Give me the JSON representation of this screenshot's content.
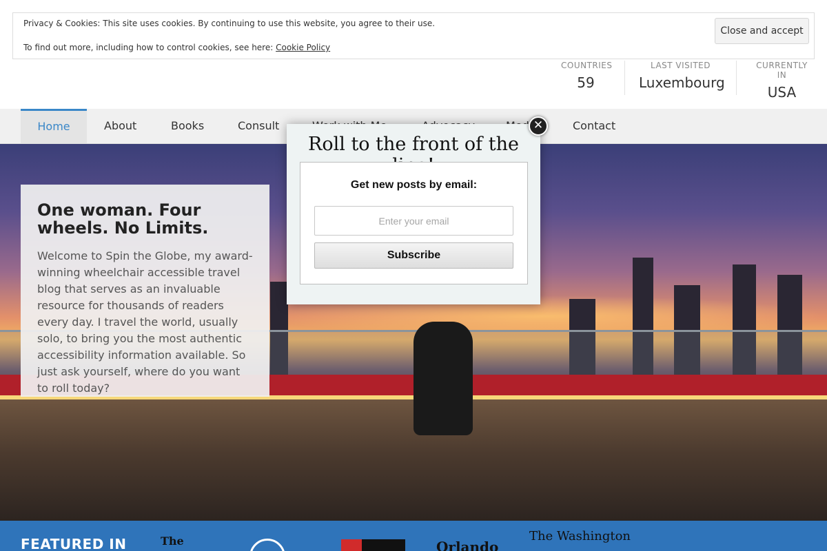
{
  "cookie_bar": {
    "line1": "Privacy & Cookies: This site uses cookies. By continuing to use this website, you agree to their use.",
    "line2_prefix": "To find out more, including how to control cookies, see here: ",
    "link": "Cookie Policy",
    "button": "Close and accept"
  },
  "stats": [
    {
      "label": "COUNTRIES",
      "value": "59"
    },
    {
      "label": "LAST VISITED",
      "value": "Luxembourg"
    },
    {
      "label": "CURRENTLY IN",
      "value": "USA"
    }
  ],
  "nav": {
    "home": "Home",
    "about": "About",
    "books": "Books",
    "consult": "Consult",
    "work": "Work with Me",
    "advocacy": "Advocacy",
    "media": "Media",
    "contact": "Contact"
  },
  "hero": {
    "title": "One woman. Four wheels. No Limits.",
    "body": "Welcome to Spin the Globe, my award-winning wheelchair accessible travel blog that serves as an invaluable resource for thousands of readers every day. I travel the world, usually solo, to bring you the most authentic accessibility information available. So just ask yourself, where do you want to roll today?"
  },
  "popup": {
    "title": "Roll to the front of the line!",
    "label": "Get new posts by email:",
    "placeholder": "Enter your email",
    "button": "Subscribe",
    "close": "✕"
  },
  "featured": {
    "label": "FEATURED IN",
    "logos": [
      "The",
      "Orlando",
      "The Washington"
    ]
  },
  "colors": {
    "accent": "#3a87c8",
    "featured_bg": "#2f74ba"
  }
}
